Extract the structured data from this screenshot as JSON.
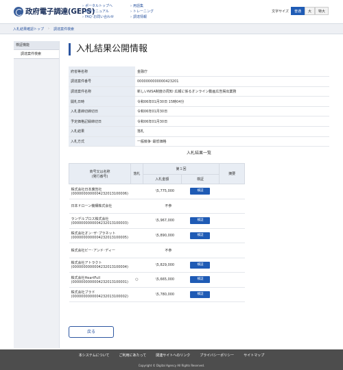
{
  "header": {
    "logo_text": "政府電子調達(GEPS)",
    "links_col1": [
      "ポータルトップへ",
      "操作マニュアル",
      "FAQ･お問い合わせ"
    ],
    "links_col2": [
      "用語集",
      "トレーニング",
      "調達情報"
    ],
    "font_size_label": "文字サイズ",
    "font_sizes": [
      "普通",
      "大",
      "特大"
    ],
    "font_size_selected": "普通"
  },
  "breadcrumb": [
    "入札結果確認トップ",
    "調達案件検索"
  ],
  "sidebar": {
    "heading": "検証機能",
    "items": [
      "調達案件検索"
    ]
  },
  "main": {
    "title": "入札結果公開情報",
    "info_rows": [
      {
        "key": "府省等名称",
        "value": "金融庁"
      },
      {
        "key": "調達案件番号",
        "value": "0000000000000423201"
      },
      {
        "key": "調達案件名称",
        "value": "新しいNISA制度の周知･広報に係るオンライン動画広告掲出業務"
      },
      {
        "key": "開札日時",
        "value": "令和06年01月30日 15時04分"
      },
      {
        "key": "入札書締切締切日",
        "value": "令和06年01月30日"
      },
      {
        "key": "予定価格記録締切日",
        "value": "令和06年01月30日"
      },
      {
        "key": "入札結果",
        "value": "落札"
      },
      {
        "key": "入札方式",
        "value": "一般競争･最低価格"
      }
    ],
    "results_title": "入札結果一覧",
    "results_headers": {
      "company": "商号又は名称\n(発行番号)",
      "winner": "落札",
      "round": "第１回",
      "amount": "入札金額",
      "verify": "検証",
      "remarks": "摘要"
    },
    "results_rows": [
      {
        "company": "株式会社日本廣告社",
        "code": "(0000000000004232013100006)",
        "winner": "",
        "amount": "\\5,775,000",
        "verify": "検証"
      },
      {
        "company": "日本ドローン機構株式会社",
        "code": "",
        "winner": "",
        "amount": "不参",
        "verify": ""
      },
      {
        "company": "ランデルプロス株式会社",
        "code": "(0000000000004232013100003)",
        "winner": "",
        "amount": "\\5,967,000",
        "verify": "検証"
      },
      {
        "company": "株式会社オン･ザ･プラネット",
        "code": "(0000000000004232013100005)",
        "winner": "",
        "amount": "\\5,890,000",
        "verify": "検証"
      },
      {
        "company": "株式会社ビー･アンド･ディー",
        "code": "",
        "winner": "",
        "amount": "不参",
        "verify": ""
      },
      {
        "company": "株式会社アトラクト",
        "code": "(0000000000004232013100004)",
        "winner": "",
        "amount": "\\5,829,000",
        "verify": "検証"
      },
      {
        "company": "株式会社HeartFull",
        "code": "(0000000000004232013100001)",
        "winner": "○",
        "amount": "\\5,665,000",
        "verify": "検証"
      },
      {
        "company": "株式会社ブラド",
        "code": "(0000000000004232013100002)",
        "winner": "",
        "amount": "\\5,780,000",
        "verify": "検証"
      }
    ],
    "back_label": "戻る"
  },
  "footer": {
    "links": [
      "本システムについて",
      "ご利用にあたって",
      "関連サイトへのリンク",
      "プライバシーポリシー",
      "サイトマップ"
    ],
    "copyright": "Copyright © Digital Agency All Rights Reserved."
  },
  "colors": {
    "accent": "#1f5bb5",
    "label_bg": "#e8edf4",
    "footer_bg": "#4d4d4d"
  }
}
